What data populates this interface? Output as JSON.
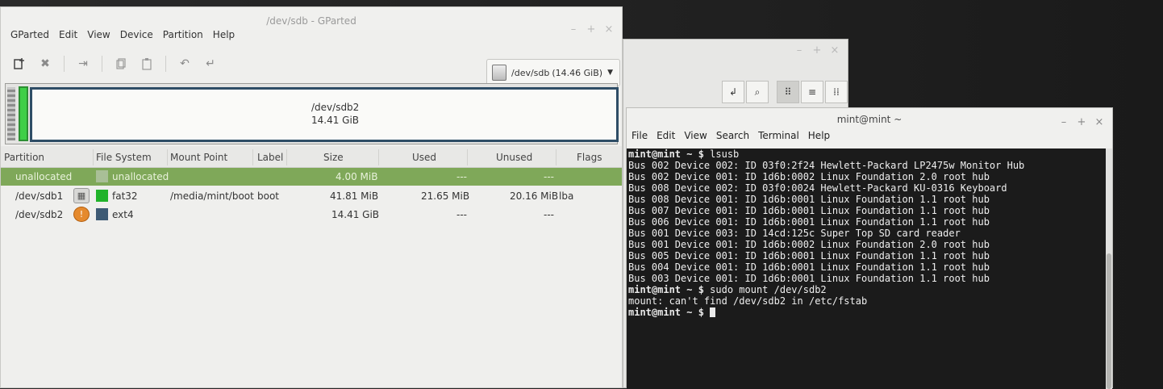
{
  "gparted": {
    "title": "/dev/sdb - GParted",
    "menu": [
      "GParted",
      "Edit",
      "View",
      "Device",
      "Partition",
      "Help"
    ],
    "toolbar_icons": [
      "new-partition-icon",
      "delete-icon",
      "resize-icon",
      "copy-icon",
      "paste-icon",
      "undo-icon",
      "apply-icon"
    ],
    "device": {
      "name": "/dev/sdb",
      "size": "(14.46 GiB)"
    },
    "partition_map": {
      "name": "/dev/sdb2",
      "size": "14.41 GiB"
    },
    "columns": [
      "Partition",
      "File System",
      "Mount Point",
      "Label",
      "Size",
      "Used",
      "Unused",
      "Flags"
    ],
    "rows": [
      {
        "partition": "unallocated",
        "fs": "unallocated",
        "mount": "",
        "label": "",
        "size": "4.00 MiB",
        "used": "---",
        "unused": "---",
        "flags": "",
        "fs_color": "#a9bf97",
        "icon": "",
        "selected": true
      },
      {
        "partition": "/dev/sdb1",
        "fs": "fat32",
        "mount": "/media/mint/boot",
        "label": "boot",
        "size": "41.81 MiB",
        "used": "21.65 MiB",
        "unused": "20.16 MiB",
        "flags": "lba",
        "fs_color": "#20b32a",
        "icon": "lock-icon",
        "selected": false
      },
      {
        "partition": "/dev/sdb2",
        "fs": "ext4",
        "mount": "",
        "label": "",
        "size": "14.41 GiB",
        "used": "---",
        "unused": "---",
        "flags": "",
        "fs_color": "#3d5a74",
        "icon": "warning-icon",
        "selected": false
      }
    ]
  },
  "terminal": {
    "title": "mint@mint ~",
    "menu": [
      "File",
      "Edit",
      "View",
      "Search",
      "Terminal",
      "Help"
    ],
    "prompt": "mint@mint ~ $",
    "lines": [
      {
        "prompt": true,
        "text": "lsusb"
      },
      {
        "prompt": false,
        "text": "Bus 002 Device 002: ID 03f0:2f24 Hewlett-Packard LP2475w Monitor Hub"
      },
      {
        "prompt": false,
        "text": "Bus 002 Device 001: ID 1d6b:0002 Linux Foundation 2.0 root hub"
      },
      {
        "prompt": false,
        "text": "Bus 008 Device 002: ID 03f0:0024 Hewlett-Packard KU-0316 Keyboard"
      },
      {
        "prompt": false,
        "text": "Bus 008 Device 001: ID 1d6b:0001 Linux Foundation 1.1 root hub"
      },
      {
        "prompt": false,
        "text": "Bus 007 Device 001: ID 1d6b:0001 Linux Foundation 1.1 root hub"
      },
      {
        "prompt": false,
        "text": "Bus 006 Device 001: ID 1d6b:0001 Linux Foundation 1.1 root hub"
      },
      {
        "prompt": false,
        "text": "Bus 001 Device 003: ID 14cd:125c Super Top SD card reader"
      },
      {
        "prompt": false,
        "text": "Bus 001 Device 001: ID 1d6b:0002 Linux Foundation 2.0 root hub"
      },
      {
        "prompt": false,
        "text": "Bus 005 Device 001: ID 1d6b:0001 Linux Foundation 1.1 root hub"
      },
      {
        "prompt": false,
        "text": "Bus 004 Device 001: ID 1d6b:0001 Linux Foundation 1.1 root hub"
      },
      {
        "prompt": false,
        "text": "Bus 003 Device 001: ID 1d6b:0001 Linux Foundation 1.1 root hub"
      },
      {
        "prompt": true,
        "text": "sudo mount /dev/sdb2"
      },
      {
        "prompt": false,
        "text": "mount: can't find /dev/sdb2 in /etc/fstab"
      },
      {
        "prompt": true,
        "text": "",
        "cursor": true
      }
    ]
  },
  "file_window": {
    "tool_icons": [
      "path-bar-icon",
      "search-icon",
      "icon-view-icon",
      "list-view-icon",
      "compact-view-icon"
    ]
  }
}
